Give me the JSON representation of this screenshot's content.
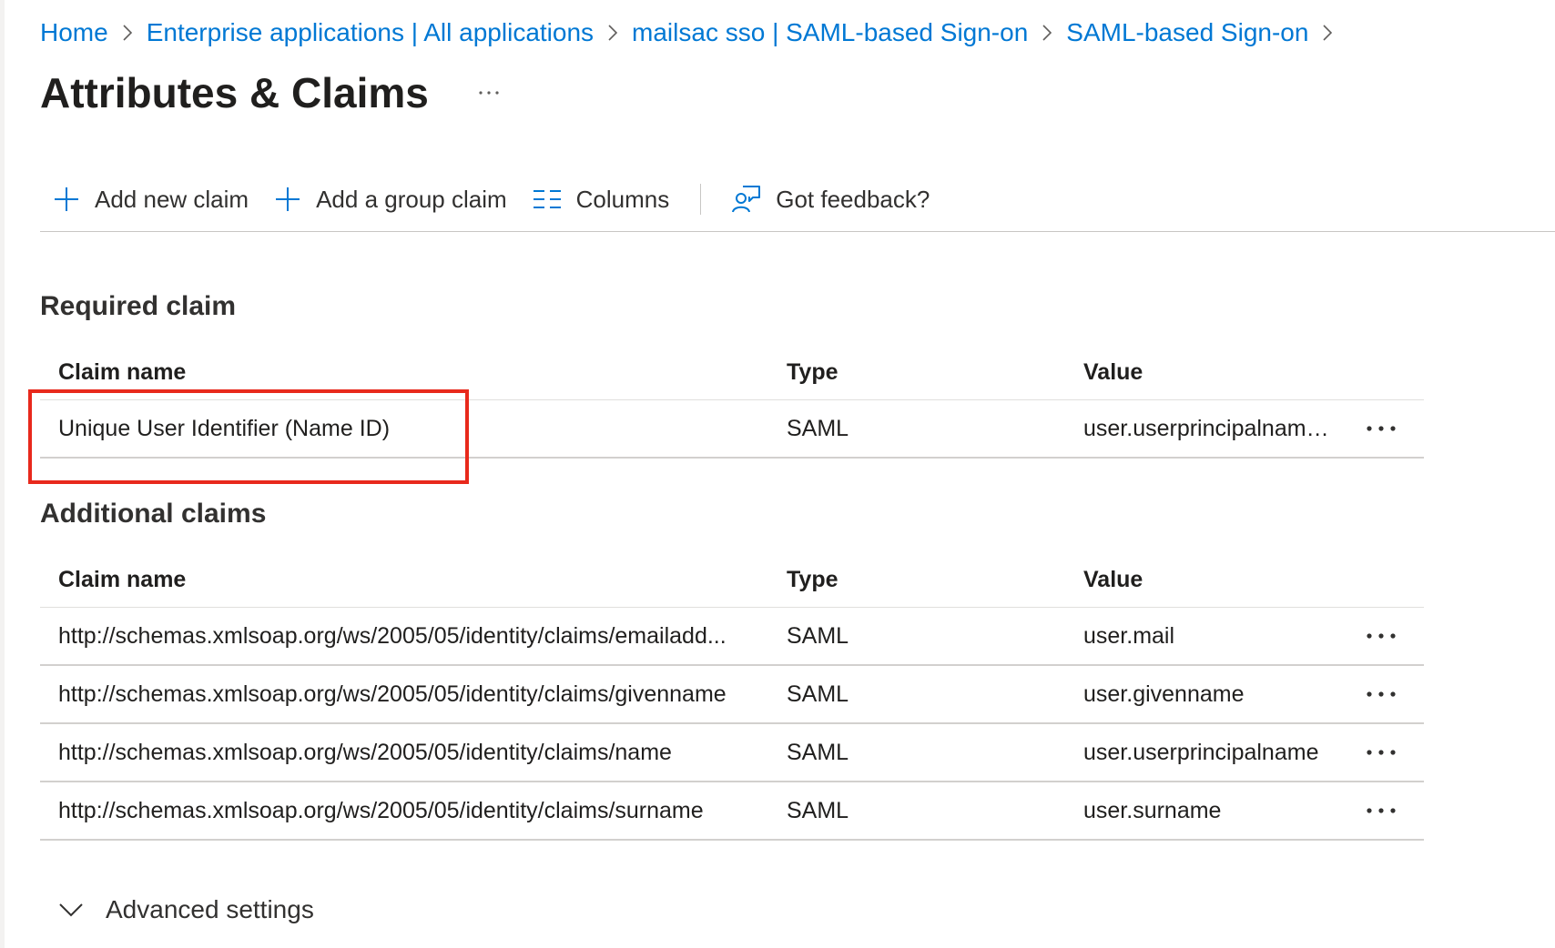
{
  "breadcrumb": {
    "items": [
      {
        "label": "Home"
      },
      {
        "label": "Enterprise applications | All applications"
      },
      {
        "label": "mailsac sso | SAML-based Sign-on"
      },
      {
        "label": "SAML-based Sign-on"
      }
    ]
  },
  "page": {
    "title": "Attributes & Claims",
    "more_icon": "ellipsis-icon"
  },
  "toolbar": {
    "add_new_claim": {
      "label": "Add new claim",
      "icon": "plus-icon"
    },
    "add_group_claim": {
      "label": "Add a group claim",
      "icon": "plus-icon"
    },
    "columns": {
      "label": "Columns",
      "icon": "columns-icon"
    },
    "feedback": {
      "label": "Got feedback?",
      "icon": "feedback-icon"
    }
  },
  "required": {
    "title": "Required claim",
    "columns": {
      "name": "Claim name",
      "type": "Type",
      "value": "Value"
    },
    "rows": [
      {
        "name": "Unique User Identifier (Name ID)",
        "type": "SAML",
        "value": "user.userprincipalname [..."
      }
    ]
  },
  "additional": {
    "title": "Additional claims",
    "columns": {
      "name": "Claim name",
      "type": "Type",
      "value": "Value"
    },
    "rows": [
      {
        "name": "http://schemas.xmlsoap.org/ws/2005/05/identity/claims/emailadd...",
        "type": "SAML",
        "value": "user.mail"
      },
      {
        "name": "http://schemas.xmlsoap.org/ws/2005/05/identity/claims/givenname",
        "type": "SAML",
        "value": "user.givenname"
      },
      {
        "name": "http://schemas.xmlsoap.org/ws/2005/05/identity/claims/name",
        "type": "SAML",
        "value": "user.userprincipalname"
      },
      {
        "name": "http://schemas.xmlsoap.org/ws/2005/05/identity/claims/surname",
        "type": "SAML",
        "value": "user.surname"
      }
    ]
  },
  "advanced": {
    "label": "Advanced settings",
    "icon": "chevron-down-icon"
  },
  "colors": {
    "link": "#0078d4",
    "highlight": "#e8291c",
    "divider": "#d2d0ce"
  }
}
